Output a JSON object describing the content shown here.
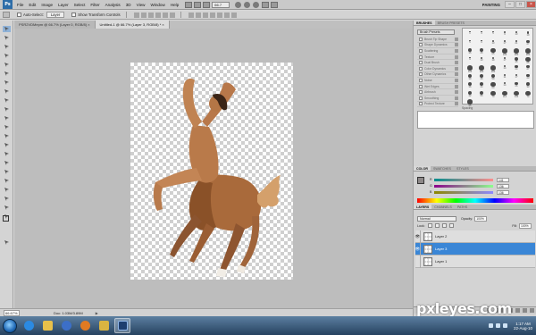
{
  "app": {
    "logo_text": "Ps",
    "menu": [
      "File",
      "Edit",
      "Image",
      "Layer",
      "Select",
      "Filter",
      "Analysis",
      "3D",
      "View",
      "Window",
      "Help"
    ],
    "zoom_menu": "66.7",
    "workspace": "PAINTING",
    "window_controls": {
      "minimize": "–",
      "restore": "□",
      "close": "×"
    }
  },
  "options_bar": {
    "auto_select_label": "Auto-Select:",
    "auto_select_value": "Layer",
    "show_transform_label": "Show Transform Controls"
  },
  "document_tabs": [
    {
      "label": "PSR2VDMepm @ 66.7% (Layer 0, RGB/8) ×",
      "active": false
    },
    {
      "label": "Untitled-1 @ 66.7% (Layer 3, RGB/8) * ×",
      "active": true
    }
  ],
  "status": {
    "zoom": "66.67%",
    "doc_size": "Doc: 1.03M/3.89M",
    "arrow": "▶"
  },
  "brushes_panel": {
    "tabs": [
      "BRUSHES",
      "BRUSH PRESETS"
    ],
    "preset_button": "Brush Presets",
    "options": [
      {
        "label": "Brush Tip Shape",
        "checked": false
      },
      {
        "label": "Shape Dynamics",
        "checked": false
      },
      {
        "label": "Scattering",
        "checked": false
      },
      {
        "label": "Texture",
        "checked": false
      },
      {
        "label": "Dual Brush",
        "checked": false
      },
      {
        "label": "Color Dynamics",
        "checked": false
      },
      {
        "label": "Other Dynamics",
        "checked": false
      },
      {
        "label": "Noise",
        "checked": false
      },
      {
        "label": "Wet Edges",
        "checked": false
      },
      {
        "label": "Airbrush",
        "checked": false
      },
      {
        "label": "Smoothing",
        "checked": false
      },
      {
        "label": "Protect Texture",
        "checked": false
      }
    ],
    "tips": [
      "1",
      "3",
      "5",
      "9",
      "13",
      "19",
      "5",
      "9",
      "13",
      "17",
      "21",
      "27",
      "35",
      "45",
      "65",
      "100",
      "200",
      "300",
      "9",
      "13",
      "19",
      "17",
      "45",
      "65",
      "100",
      "200",
      "300",
      "14",
      "24",
      "27",
      "39",
      "46",
      "59",
      "11",
      "17",
      "23",
      "36",
      "44",
      "60",
      "14",
      "26",
      "33",
      "42",
      "55",
      "70",
      "112",
      "134",
      "74",
      "95"
    ],
    "spacing_label": "Spacing"
  },
  "color_panel": {
    "tabs": [
      "COLOR",
      "SWATCHES",
      "STYLES"
    ],
    "channels": [
      {
        "letter": "R",
        "value": "141",
        "track_from": "#008d8d",
        "track_to": "#ff8d8d"
      },
      {
        "letter": "G",
        "value": "136",
        "track_from": "#8d008d",
        "track_to": "#8dff8d"
      },
      {
        "letter": "B",
        "value": "136",
        "track_from": "#8d8800",
        "track_to": "#8d88ff"
      }
    ],
    "foreground": "#8d8888",
    "background": "#ffffff"
  },
  "layers_panel": {
    "tabs": [
      "LAYERS",
      "CHANNELS",
      "PATHS"
    ],
    "blend_mode": "Normal",
    "opacity_label": "Opacity:",
    "opacity_value": "100%",
    "lock_label": "Lock:",
    "fill_label": "Fill:",
    "fill_value": "100%",
    "layers": [
      {
        "name": "Layer 2",
        "visible": true,
        "selected": false
      },
      {
        "name": "Layer 3",
        "visible": true,
        "selected": true
      },
      {
        "name": "Layer 1",
        "visible": false,
        "selected": false
      }
    ]
  },
  "taskbar": {
    "apps": [
      "ie-icon",
      "explorer-icon",
      "media-icon",
      "firefox-icon",
      "folder-icon",
      "photoshop-icon"
    ],
    "active_app": "photoshop-icon",
    "clock_time": "1:17 AM",
    "clock_date": "22-Aug-10"
  },
  "watermark": "pxleyes.com",
  "colors": {
    "selection_blue": "#3a86d6",
    "panel_gray": "#d3d3d3",
    "taskbar_top": "#5c7fa1",
    "taskbar_bottom": "#26425f"
  }
}
